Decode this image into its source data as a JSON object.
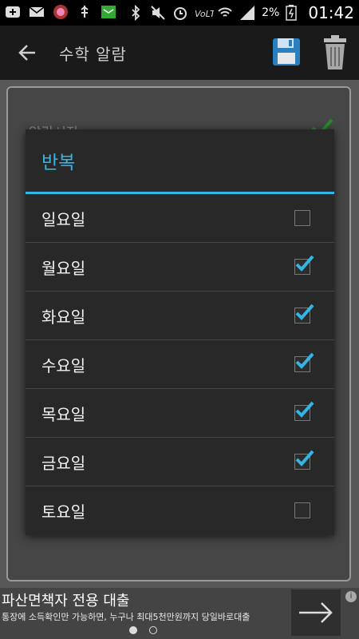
{
  "status_bar": {
    "time": "01:42",
    "battery_percent": "2%",
    "icons": [
      "add-icon",
      "mail-icon",
      "app-icon",
      "usb-icon",
      "message-icon",
      "bluetooth-icon",
      "mute-icon",
      "alarm-icon",
      "volte-icon",
      "wifi-icon",
      "signal-icon",
      "battery-charging-icon"
    ]
  },
  "action_bar": {
    "title": "수학 알람",
    "icons": [
      "back-arrow-icon",
      "save-floppy-icon",
      "trash-icon"
    ]
  },
  "background": {
    "label": "알람시작"
  },
  "dialog": {
    "title": "반복",
    "accent_color": "#33b5e5",
    "items": [
      {
        "label": "일요일",
        "checked": false
      },
      {
        "label": "월요일",
        "checked": true
      },
      {
        "label": "화요일",
        "checked": true
      },
      {
        "label": "수요일",
        "checked": true
      },
      {
        "label": "목요일",
        "checked": true
      },
      {
        "label": "금요일",
        "checked": true
      },
      {
        "label": "토요일",
        "checked": false
      }
    ]
  },
  "ad": {
    "title": "파산면책자 전용 대출",
    "subtitle": "통장에 소득확인만 가능하면, 누구나 최대5천만원까지 당일바로대출",
    "info": "i",
    "page_dots": {
      "count": 2,
      "active": 0
    }
  }
}
